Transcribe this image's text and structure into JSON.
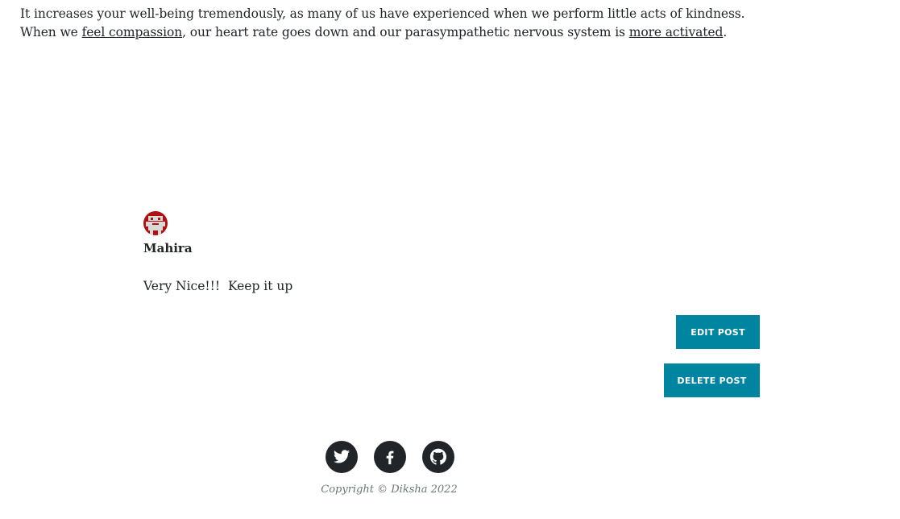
{
  "post": {
    "text_part1": "It increases your well-being tremendously, as many of us have experienced when we perform little acts of kindness. When we ",
    "link1": "feel compassion",
    "text_part2": ", our heart rate goes down and our parasympathetic nervous system is ",
    "link2": "more activated",
    "text_part3": "."
  },
  "comment": {
    "author": "Mahira",
    "body": "Very Nice!!!  Keep it up"
  },
  "actions": {
    "edit_label": "Edit Post",
    "delete_label": "Delete Post",
    "accent_color": "#0085a1"
  },
  "footer": {
    "social": [
      "twitter-icon",
      "facebook-icon",
      "github-icon"
    ],
    "copyright": "Copyright © Diksha 2022"
  }
}
